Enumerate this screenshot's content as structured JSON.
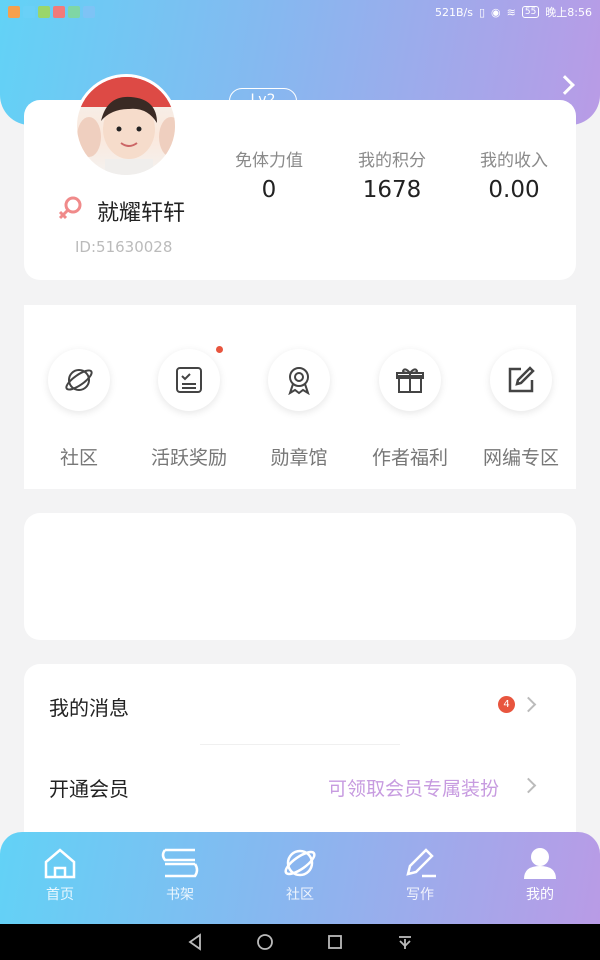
{
  "status_bar": {
    "network_speed": "521B/s",
    "battery": "55",
    "time": "晚上8:56",
    "app_icons": [
      "app-icon-1",
      "app-icon-2",
      "app-icon-3",
      "app-icon-4",
      "app-icon-5",
      "app-icon-6"
    ]
  },
  "profile": {
    "level": "Lv2",
    "username": "就耀轩轩",
    "user_id": "ID:51630028",
    "gender_icon": "female-icon",
    "stats": [
      {
        "label": "免体力值",
        "value": "0"
      },
      {
        "label": "我的积分",
        "value": "1678"
      },
      {
        "label": "我的收入",
        "value": "0.00"
      }
    ]
  },
  "menu": [
    {
      "label": "社区",
      "icon": "planet-icon"
    },
    {
      "label": "活跃奖励",
      "icon": "checklist-icon",
      "has_dot": true
    },
    {
      "label": "勋章馆",
      "icon": "medal-icon"
    },
    {
      "label": "作者福利",
      "icon": "gift-icon"
    },
    {
      "label": "网编专区",
      "icon": "edit-square-icon"
    }
  ],
  "list": {
    "messages": {
      "title": "我的消息",
      "badge": "4"
    },
    "vip": {
      "title": "开通会员",
      "subtitle": "可领取会员专属装扮"
    }
  },
  "tabs": [
    {
      "label": "首页",
      "icon": "home-icon"
    },
    {
      "label": "书架",
      "icon": "bookshelf-icon"
    },
    {
      "label": "社区",
      "icon": "planet-icon"
    },
    {
      "label": "写作",
      "icon": "pen-icon"
    },
    {
      "label": "我的",
      "icon": "user-icon",
      "active": true
    }
  ],
  "colors": {
    "gradient_start": "#62d2f6",
    "gradient_end": "#b99be6",
    "accent_purple": "#c79be0",
    "badge_red": "#e8553e"
  }
}
